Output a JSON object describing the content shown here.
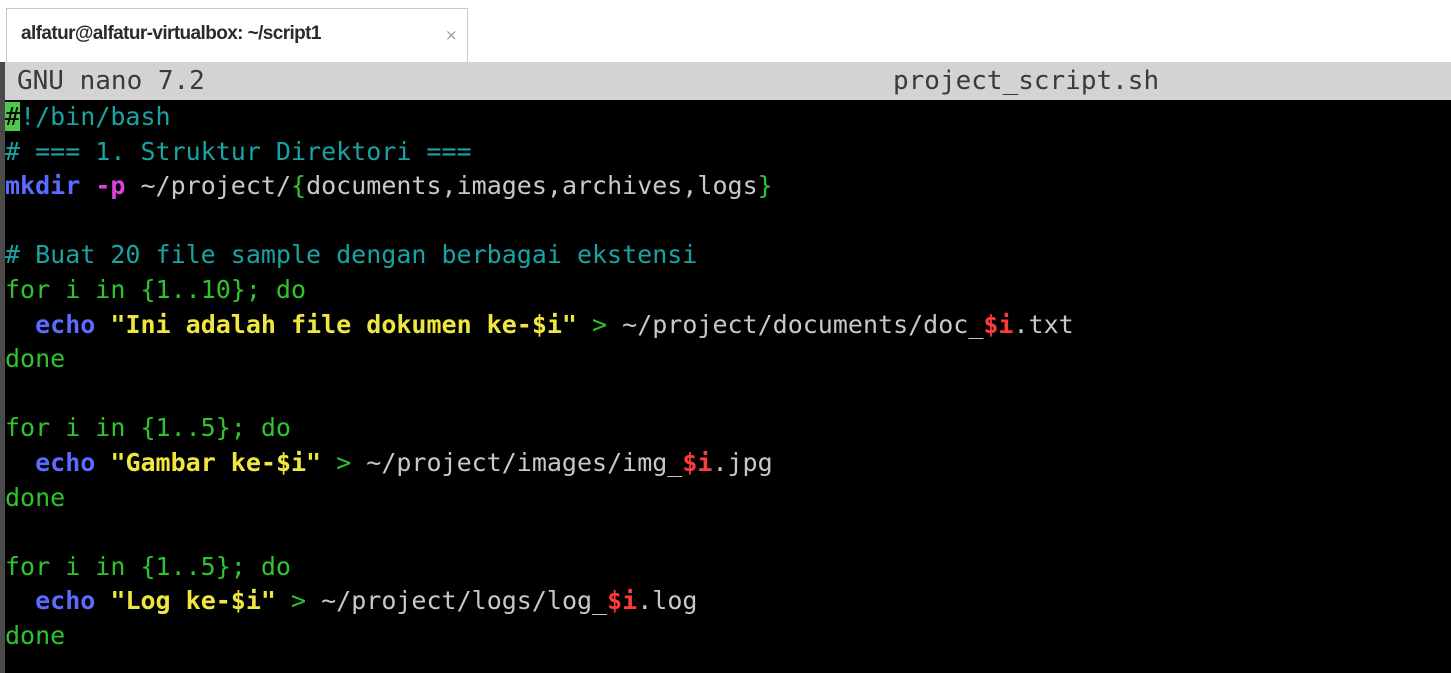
{
  "tab": {
    "title": "alfatur@alfatur-virtualbox: ~/script1",
    "close_glyph": "×"
  },
  "nano": {
    "version_label": "GNU nano 7.2",
    "filename": "project_script.sh"
  },
  "colors": {
    "cursor": "#4ec94e",
    "comment": "#1aa3a3",
    "keyword": "#2ec42e",
    "command": "#5a6cff",
    "flag": "#e040e0",
    "string": "#f0e640",
    "variable": "#ff3a3a"
  },
  "code": {
    "l1_cursor": "#",
    "l1_rest": "!/bin/bash",
    "l2": "# === 1. Struktur Direktori ===",
    "l3_cmd": "mkdir",
    "l3_flag": "-p",
    "l3_path": " ~/project/",
    "l3_open": "{",
    "l3_items": "documents,images,archives,logs",
    "l3_close": "}",
    "l5": "# Buat 20 file sample dengan berbagai ekstensi",
    "l6": "for i in {1..10}; do",
    "l7_echo": "echo",
    "l7_str": "\"Ini adalah file dokumen ke-$i\"",
    "l7_op": " > ",
    "l7_path": "~/project/documents/doc_",
    "l7_var": "$i",
    "l7_ext": ".txt",
    "l8": "done",
    "l10": "for i in {1..5}; do",
    "l11_echo": "echo",
    "l11_str": "\"Gambar ke-$i\"",
    "l11_op": " > ",
    "l11_path": "~/project/images/img_",
    "l11_var": "$i",
    "l11_ext": ".jpg",
    "l12": "done",
    "l14": "for i in {1..5}; do",
    "l15_echo": "echo",
    "l15_str": "\"Log ke-$i\"",
    "l15_op": " > ",
    "l15_path": "~/project/logs/log_",
    "l15_var": "$i",
    "l15_ext": ".log",
    "l16": "done"
  }
}
